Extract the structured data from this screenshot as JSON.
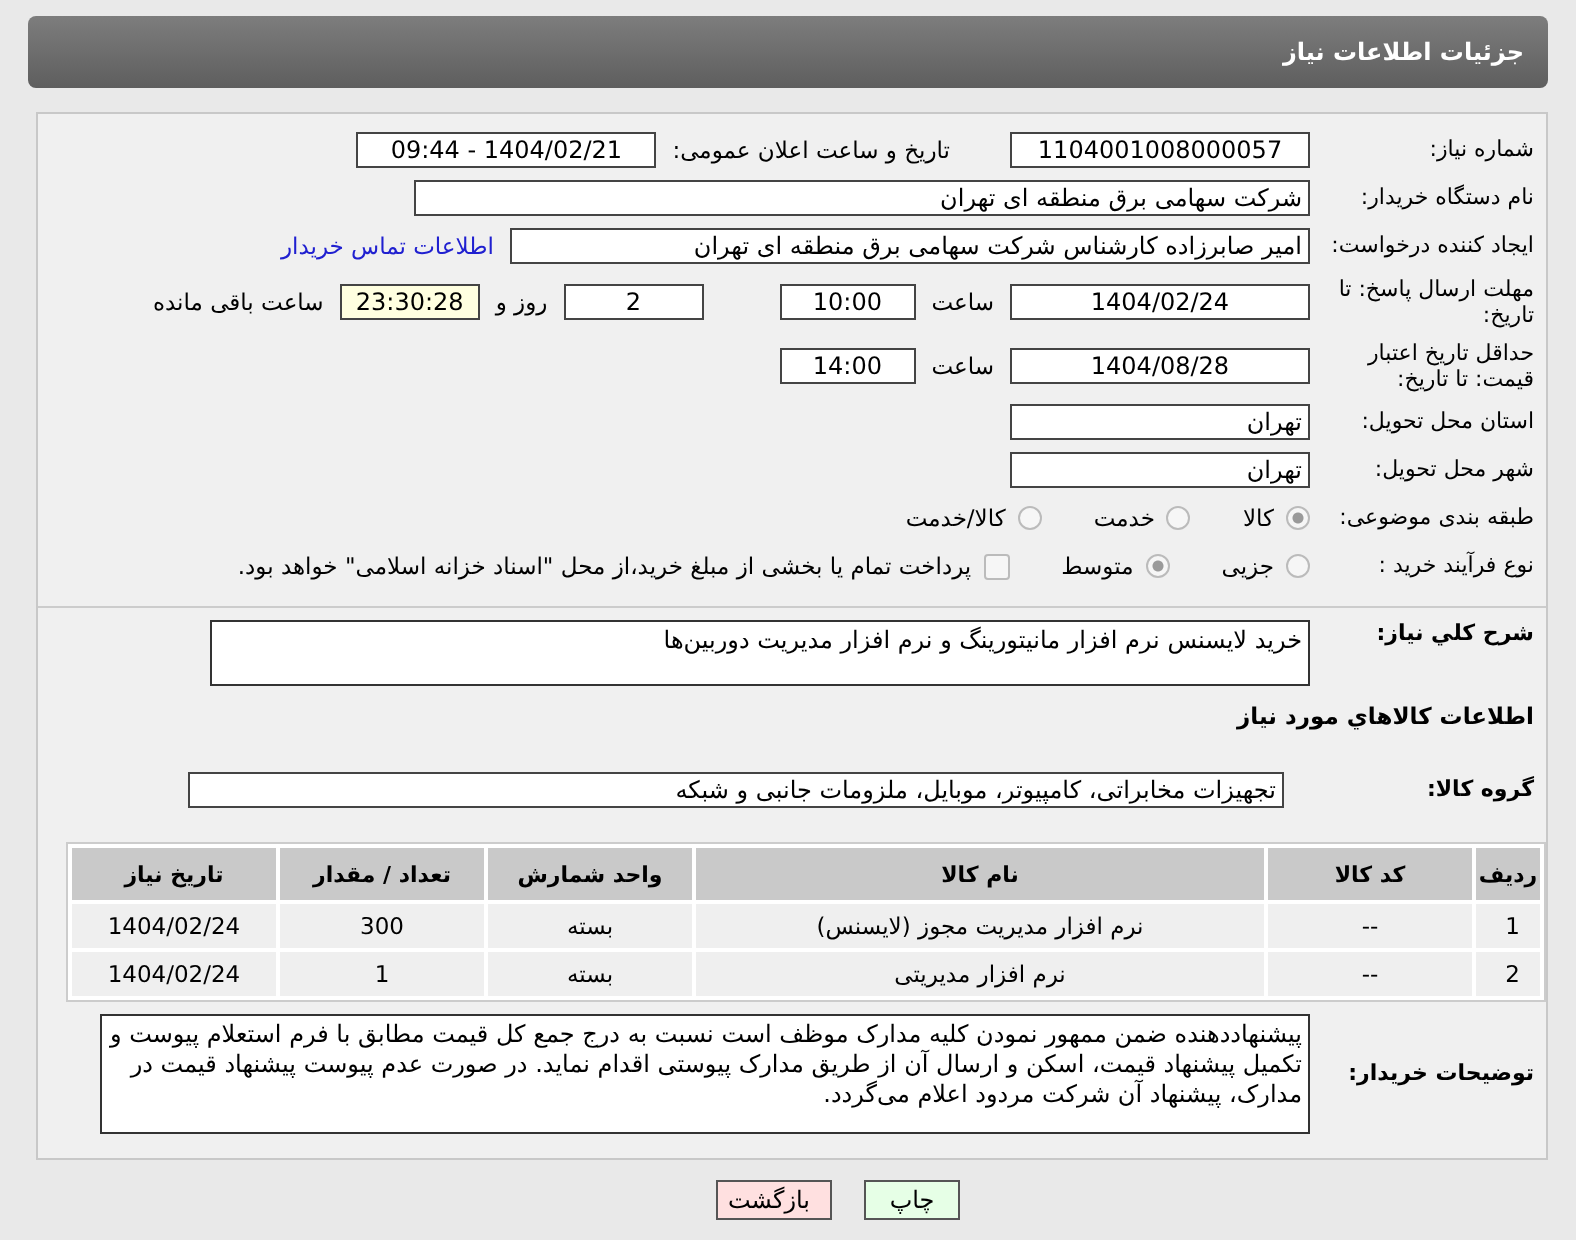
{
  "header": {
    "title": "جزئیات اطلاعات نیاز"
  },
  "need_number": {
    "label": "شماره نیاز:",
    "value": "1104001008000057"
  },
  "announce": {
    "label": "تاریخ و ساعت اعلان عمومی:",
    "value": "1404/02/21 - 09:44"
  },
  "buyer": {
    "label": "نام دستگاه خریدار:",
    "value": "شرکت سهامی برق منطقه ای تهران"
  },
  "creator": {
    "label": "ایجاد کننده درخواست:",
    "value": "امیر صابرزاده کارشناس شرکت سهامی برق منطقه ای تهران",
    "link": "اطلاعات تماس خریدار"
  },
  "deadline": {
    "label": "مهلت ارسال پاسخ: تا تاریخ:",
    "date": "1404/02/24",
    "time_label": "ساعت",
    "time": "10:00",
    "days": "2",
    "days_label": "روز و",
    "remaining": "23:30:28",
    "remaining_label": "ساعت باقی مانده"
  },
  "validity": {
    "label": "حداقل تاریخ اعتبار قیمت: تا تاریخ:",
    "date": "1404/08/28",
    "time_label": "ساعت",
    "time": "14:00"
  },
  "province": {
    "label": "استان محل تحویل:",
    "value": "تهران"
  },
  "city": {
    "label": "شهر محل تحویل:",
    "value": "تهران"
  },
  "category": {
    "label": "طبقه بندی موضوعی:",
    "options": [
      {
        "label": "کالا",
        "selected": true
      },
      {
        "label": "خدمت",
        "selected": false
      },
      {
        "label": "کالا/خدمت",
        "selected": false
      }
    ]
  },
  "process": {
    "label": "نوع فرآیند خرید :",
    "options": [
      {
        "label": "جزیی",
        "selected": false
      },
      {
        "label": "متوسط",
        "selected": true
      }
    ],
    "payment": {
      "checked": false,
      "text": "پرداخت تمام یا بخشی از مبلغ خرید،از محل \"اسناد خزانه اسلامی\" خواهد بود."
    }
  },
  "description": {
    "label": "شرح کلي نیاز:",
    "value": "خرید لایسنس نرم افزار مانیتورینگ و نرم افزار مدیریت دوربین‌ها"
  },
  "goods_title": "اطلاعات کالاهاي مورد نیاز",
  "group": {
    "label": "گروه کالا:",
    "value": "تجهیزات مخابراتی، کامپیوتر، موبایل، ملزومات جانبی و شبکه"
  },
  "table": {
    "columns": [
      "ردیف",
      "کد کالا",
      "نام کالا",
      "واحد شمارش",
      "تعداد / مقدار",
      "تاریخ نیاز"
    ],
    "rows": [
      [
        "1",
        "--",
        "نرم افزار مدیریت مجوز (لایسنس)",
        "بسته",
        "300",
        "1404/02/24"
      ],
      [
        "2",
        "--",
        "نرم افزار مدیریتی",
        "بسته",
        "1",
        "1404/02/24"
      ]
    ]
  },
  "notes": {
    "label": "توضیحات خریدار:",
    "value": "پیشنهاددهنده ضمن ممهور نمودن کلیه مدارک موظف است نسبت به درج جمع کل قیمت مطابق با فرم استعلام پیوست و تکمیل پیشنهاد قیمت، اسکن و ارسال آن از طریق مدارک پیوستی اقدام نماید. در صورت عدم پیوست پیشنهاد قیمت در مدارک، پیشنهاد آن شرکت مردود اعلام می‌گردد."
  },
  "buttons": [
    {
      "label": "چاپ",
      "kind": "print"
    },
    {
      "label": "بازگشت",
      "kind": "back"
    }
  ]
}
